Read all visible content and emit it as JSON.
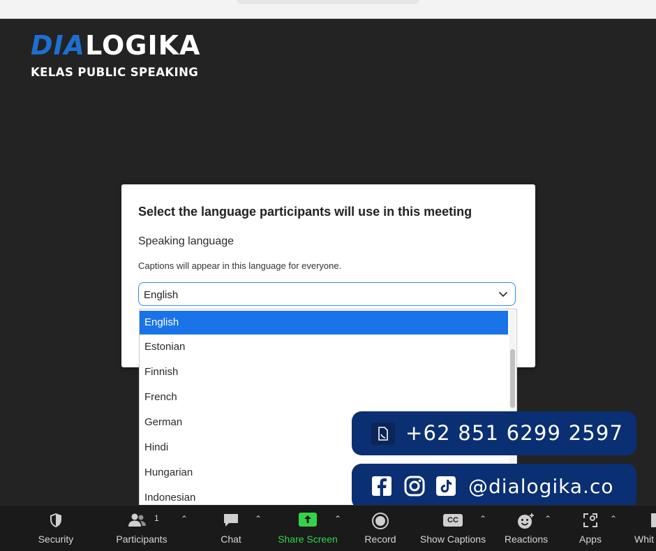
{
  "brand": {
    "logo_part1": "DIA",
    "logo_part2": "LOGIKA",
    "subtitle": "KELAS PUBLIC SPEAKING"
  },
  "dialog": {
    "title": "Select the language participants will use in this meeting",
    "label": "Speaking language",
    "description": "Captions will appear in this language for everyone.",
    "selected_value": "English"
  },
  "dropdown": {
    "options": [
      "English",
      "Estonian",
      "Finnish",
      "French",
      "German",
      "Hindi",
      "Hungarian",
      "Indonesian"
    ],
    "selected_index": 0
  },
  "contact": {
    "phone": "+62 851 6299 2597",
    "handle": "@dialogika.co",
    "icons": [
      "phone-icon",
      "facebook-icon",
      "instagram-icon",
      "tiktok-icon"
    ]
  },
  "toolbar": {
    "security": "Security",
    "participants": "Participants",
    "participants_count": "1",
    "chat": "Chat",
    "share_screen": "Share Screen",
    "record": "Record",
    "show_captions": "Show Captions",
    "captions_badge": "CC",
    "reactions": "Reactions",
    "apps": "Apps",
    "whiteboards": "Whit"
  },
  "colors": {
    "accent_blue": "#1a73e8",
    "select_border": "#2d8cff",
    "brand_navy": "#0a2f73",
    "share_green": "#35d34a",
    "logo_blue": "#1e6fd1"
  }
}
